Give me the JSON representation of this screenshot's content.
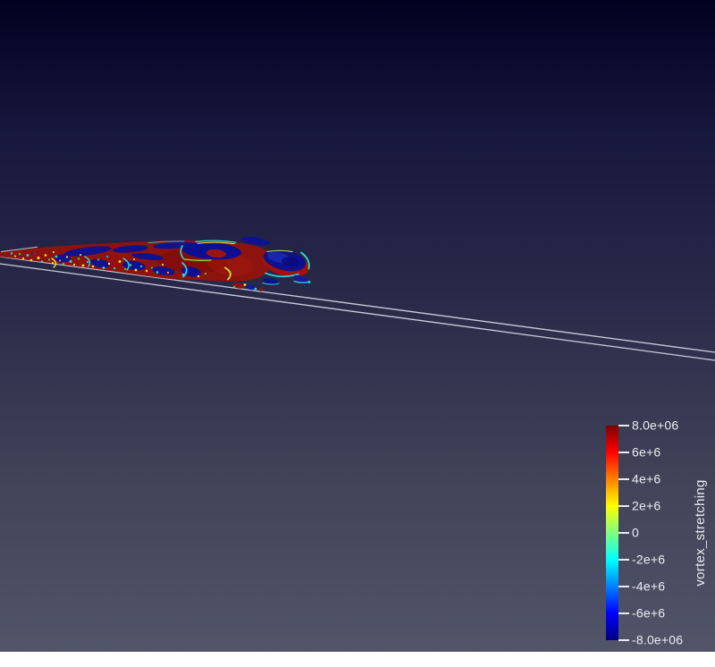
{
  "scene": {
    "description": "3D render view of a vortex_stretching isosurface over a flat plate",
    "background_stops": [
      [
        "#010120",
        "0%"
      ],
      [
        "#16173d",
        "20%"
      ],
      [
        "#2b2c4a",
        "48%"
      ],
      [
        "#424459",
        "75%"
      ],
      [
        "#515568",
        "100%"
      ]
    ],
    "plate_edge_color": "#d2d5e2"
  },
  "colorbar": {
    "title": "vortex_stretching",
    "tick_labels": [
      "8.0e+06",
      "6e+6",
      "4e+6",
      "2e+6",
      "0",
      "-2e+6",
      "-4e+6",
      "-6e+6",
      "-8.0e+06"
    ],
    "range_max": 8000000,
    "range_min": -8000000,
    "tick_spacing_px": 30,
    "colormap": "jet",
    "colormap_stops": [
      {
        "color": "#800000",
        "pos": "0%"
      },
      {
        "color": "#ff0000",
        "pos": "12.5%"
      },
      {
        "color": "#ff8000",
        "pos": "25%"
      },
      {
        "color": "#ffff00",
        "pos": "37.5%"
      },
      {
        "color": "#80ff80",
        "pos": "50%"
      },
      {
        "color": "#00ffff",
        "pos": "62.5%"
      },
      {
        "color": "#0080ff",
        "pos": "75%"
      },
      {
        "color": "#0000ff",
        "pos": "87.5%"
      },
      {
        "color": "#000080",
        "pos": "100%"
      }
    ]
  }
}
